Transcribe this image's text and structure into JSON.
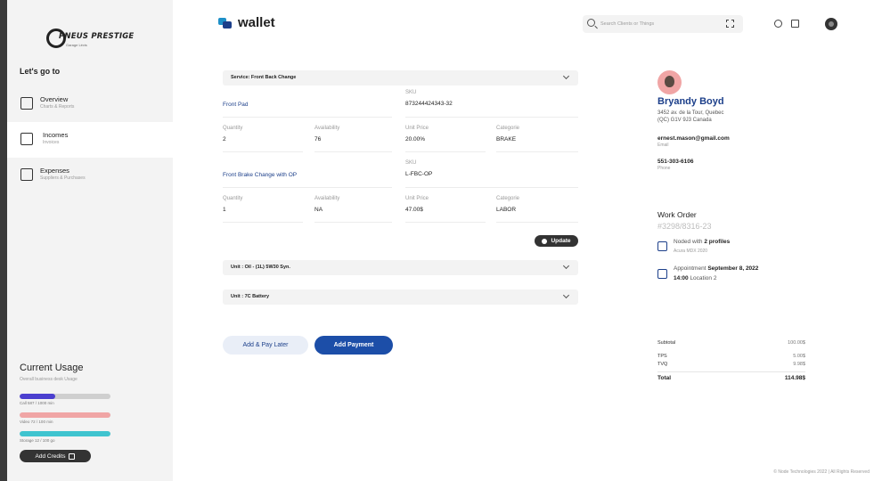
{
  "brand": {
    "logo_text": "PNEUS PRESTIGE",
    "logo_sub": "Garage Lévis"
  },
  "sidebar": {
    "heading": "Let's go to",
    "items": [
      {
        "label": "Overview",
        "sub": "Charts & Reports",
        "icon": "chart-icon",
        "active": false
      },
      {
        "label": "Incomes",
        "sub": "Invoices",
        "icon": "invoice-icon",
        "active": true
      },
      {
        "label": "Expenses",
        "sub": "Suppliers & Purchases",
        "icon": "calculator-icon",
        "active": false
      }
    ],
    "usage": {
      "title": "Current Usage",
      "subtitle": "Overall business desk Usage",
      "bars": [
        {
          "caption": "Call 587 / 1000 min",
          "percent": 39,
          "color": "#4b3fcf"
        },
        {
          "caption": "Video 72 / 100 min",
          "percent": 100,
          "color": "#f0a5a5"
        },
        {
          "caption": "Storage 12 / 100 go",
          "percent": 100,
          "color": "#3fc4cf"
        }
      ],
      "credits_label": "Add Credits"
    }
  },
  "header": {
    "title": "wallet",
    "search_placeholder": "Search Clients or Things"
  },
  "service": {
    "header": "Service: Front Back Change",
    "items": [
      {
        "name": "Front Pad",
        "sku_label": "SKU",
        "sku": "873244424343-32",
        "quantity_label": "Quantity",
        "quantity": "2",
        "availability_label": "Availability",
        "availability": "76",
        "unit_price_label": "Unit Price",
        "unit_price": "20.00%",
        "category_label": "Categorie",
        "category": "BRAKE"
      },
      {
        "name": "Front Brake Change with OP",
        "sku_label": "SKU",
        "sku": "L-FBC-OP",
        "quantity_label": "Quantity",
        "quantity": "1",
        "availability_label": "Availability",
        "availability": "NA",
        "unit_price_label": "Unit Price",
        "unit_price": "47.00$",
        "category_label": "Categorie",
        "category": "LABOR"
      }
    ],
    "update_label": "Update"
  },
  "units": [
    {
      "label": "Unit : Oil - (1L) 5W30 Syn."
    },
    {
      "label": "Unit : 7C Battery"
    }
  ],
  "actions": {
    "later_label": "Add & Pay Later",
    "pay_label": "Add Payment"
  },
  "customer": {
    "name": "Bryandy Boyd",
    "address_line1": "3452 av. de la Tour, Quebec",
    "address_line2": "(QC) G1V 9J3 Canada",
    "email": "ernest.mason@gmail.com",
    "email_label": "Email",
    "phone": "551-303-6106",
    "phone_label": "Phone"
  },
  "work_order": {
    "title": "Work Order",
    "number": "#3298/8316-23",
    "noded_prefix": "Noded with",
    "noded_profiles": "2 profiles",
    "vehicle": "Acura MDX 2020",
    "appointment_prefix": "Appointment",
    "appointment_date": "September 8, 2022",
    "appointment_time": "14:00",
    "location": "Location 2"
  },
  "totals": {
    "subtotal_label": "Subtotal",
    "subtotal": "100.00$",
    "tps_label": "TPS",
    "tps": "5.00$",
    "tvq_label": "TVQ",
    "tvq": "9.98$",
    "total_label": "Total",
    "total": "114.98$"
  },
  "footer": "© Node Technologies 2022 | All Rights Reserved"
}
